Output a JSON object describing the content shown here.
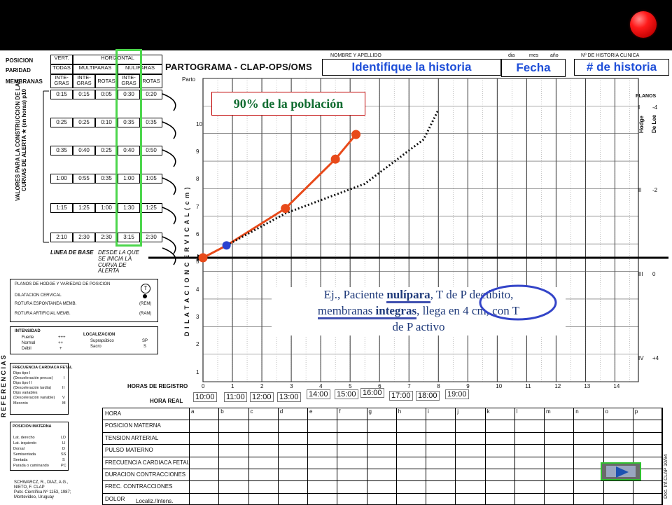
{
  "form": {
    "title": "PARTOGRAMA  - CLAP-OPS/OMS",
    "labels": {
      "posicion": "POSICION",
      "paridad": "PARIDAD",
      "membranas": "MEMBRANAS",
      "vert": "VERT.",
      "horizontal": "HORIZONTAL",
      "todas": "TODAS",
      "multiparas": "MULTIPARAS",
      "nuliparas": "NULIPARAS",
      "integras": "INTE-\nGRAS",
      "rotas": "ROTAS",
      "nombre": "NOMBRE Y APELLIDO",
      "dia": "dia",
      "mes": "mes",
      "ano": "año",
      "n_historia": "Nº DE HISTORIA CLINICA",
      "parto": "Parto",
      "planos": "PLANOS",
      "hodge": "Hodge",
      "delee": "De Lee",
      "valores": "VALORES PARA LA CONSTRUCCION DE LAS CURVAS DE ALERTA ★ (en horas) p10",
      "linea_base": "LINEA DE BASE",
      "linea_base2": "DESDE LA QUE SE INICIA LA CURVA DE ALERTA",
      "dilatacion": "D I L A T A C I O N     C E R V I C A L    ( c m )",
      "horas_registro": "HORAS DE REGISTRO",
      "hora_real": "HORA REAL",
      "referencias": "R E F E R E N C I A S",
      "doc": "Doc. Inf.CLAP 10/94"
    },
    "id_boxes": {
      "name": "Identifique la historia",
      "date": "Fecha",
      "history": "# de historia"
    },
    "alert_table": [
      [
        "0:15",
        "0:15",
        "0:05",
        "0:30",
        "0:20"
      ],
      [
        "0:25",
        "0:25",
        "0:10",
        "0:35",
        "0:35"
      ],
      [
        "0:35",
        "0:40",
        "0:25",
        "0:40",
        "0:50"
      ],
      [
        "1:00",
        "0:55",
        "0:35",
        "1:00",
        "1:05"
      ],
      [
        "1:15",
        "1:25",
        "1:00",
        "1:30",
        "1:25"
      ],
      [
        "2:10",
        "2:30",
        "2:30",
        "3:15",
        "2:30"
      ]
    ],
    "y_ticks": [
      "10",
      "9",
      "8",
      "7",
      "6",
      "5",
      "4",
      "3",
      "2",
      "1"
    ],
    "plane_labels": [
      {
        "roman": "I",
        "delee": "-4"
      },
      {
        "roman": "II",
        "delee": "-2"
      },
      {
        "roman": "III",
        "delee": "0"
      },
      {
        "roman": "IV",
        "delee": "+4"
      }
    ],
    "hour_ticks": [
      "0",
      "1",
      "2",
      "3",
      "4",
      "5",
      "6",
      "7",
      "8",
      "9",
      "10",
      "11",
      "12",
      "13",
      "14"
    ],
    "real_times": [
      "10:00",
      "11:00",
      "12:00",
      "13:00",
      "14:00",
      "15:00",
      "16:00",
      "17:00",
      "18:00",
      "19:00"
    ],
    "col_letters": [
      "a",
      "b",
      "c",
      "d",
      "e",
      "f",
      "g",
      "h",
      "i",
      "j",
      "k",
      "l",
      "m",
      "n",
      "o",
      "p"
    ],
    "rows": [
      "HORA",
      "POSICION MATERNA",
      "TENSION ARTERIAL",
      "PULSO MATERNO",
      "FRECUENCIA CARDIACA FETAL",
      "DURACION CONTRACCIONES",
      "FREC. CONTRACCIONES",
      "DOLOR"
    ],
    "dolor_sub": "Localiz./Intens.",
    "legend": {
      "planos": "PLANOS DE HODGE Y VARIEDAD DE POSICION",
      "dilatacion": "DILATACION CERVICAL",
      "rotura_esp": "ROTURA ESPONTANEA MEMB.",
      "rem": "(REM)",
      "rotura_art": "ROTURA ARTIFICIAL MEMB.",
      "ram": "(RAM)",
      "intensidad": "INTENSIDAD",
      "fuerte": "Fuerte",
      "fuerte_s": "+++",
      "normal": "Normal",
      "normal_s": "++",
      "debil": "Débil",
      "debil_s": "+",
      "localizacion": "LOCALIZACION",
      "suprapubico": "Suprapúbico",
      "sp": "SP",
      "sacro": "Sacro",
      "s": "S",
      "fcf": "FRECUENCIA CARDIACA FETAL",
      "dips1": "Dips tipo I",
      "dips1b": "(Desceleración precoz)",
      "dips1c": "I",
      "dips2": "Dips tipo II",
      "dips2b": "(Desceleración tardía)",
      "dips2c": "II",
      "dipsv": "Dips variables",
      "dipsvb": "(Desceleración variable)",
      "dipsvc": "V",
      "meconio": "Meconio",
      "meconioc": "M",
      "posmat": "POSICION MATERNA",
      "latder": "Lat. derecho",
      "ld": "LD",
      "latizq": "Lat. izquierdo",
      "li": "LI",
      "dorsal": "Dorsal",
      "d": "D",
      "semi": "Semisentada",
      "ss": "SS",
      "sentada": "Sentada",
      "s2": "S",
      "parada": "Parada o caminando",
      "pc": "PC",
      "ref1": "SCHWARCZ, R., DIAZ, A.G.,",
      "ref2": "NIETO, F. CLAP",
      "ref3": "Publ. Científica Nº 1153, 1987;",
      "ref4": "Montevideo, Uruguay"
    }
  },
  "annotations": {
    "population": "90% de la población",
    "note_line1_a": "Ej., Paciente ",
    "note_nul": "nulípara",
    "note_line1_b": ", T de P decúbito,",
    "note_memb": "membranas ",
    "note_integras": "integras",
    "note_line2_b": ", llega en 4 cm,  con T",
    "note_line3": "de P activo"
  },
  "chart_data": {
    "type": "line",
    "xlabel": "HORAS DE REGISTRO",
    "ylabel": "DILATACION CERVICAL (cm)",
    "xlim": [
      0,
      14
    ],
    "ylim": [
      0,
      10
    ],
    "series": [
      {
        "values_x": [
          0,
          0.8,
          2.8,
          4.5,
          5.2
        ],
        "values_y": [
          4,
          4.5,
          6,
          8,
          9
        ],
        "color": "#e84a1a"
      },
      {
        "values_x": [
          0.8,
          2.8,
          5.5,
          7.5,
          8.0
        ],
        "values_y": [
          4.5,
          5.8,
          7,
          8.8,
          10
        ],
        "color": "#111111",
        "style": "dotted"
      }
    ],
    "points": [
      {
        "x": 0,
        "y": 4,
        "color": "#e84a1a"
      },
      {
        "x": 0.8,
        "y": 4.5,
        "color": "#2a42d0"
      },
      {
        "x": 2.8,
        "y": 6,
        "color": "#e84a1a"
      },
      {
        "x": 4.5,
        "y": 8,
        "color": "#e84a1a"
      },
      {
        "x": 5.2,
        "y": 9,
        "color": "#e84a1a"
      }
    ]
  }
}
